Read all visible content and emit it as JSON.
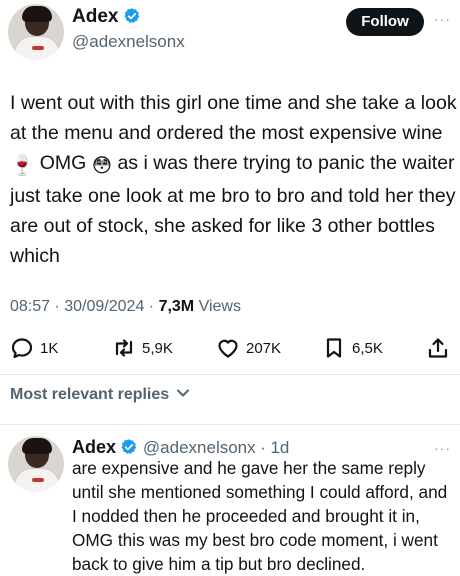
{
  "tweet": {
    "author_name": "Adex",
    "author_handle": "@adexnelsonx",
    "follow_label": "Follow",
    "text_part1": "I went out with this girl one time and she take a look at the menu and ordered the most expensive wine ",
    "wine_emoji": "🍷",
    "text_part2": " OMG ",
    "flushed_emoji": "😳",
    "text_part3": " as i was there trying to panic the waiter just take one look at me bro to bro and told her they are out of stock, she asked for like 3 other bottles which",
    "time": "08:57 · 30/09/2024 · ",
    "views_count": "7,3M",
    "views_label": " Views"
  },
  "actions": {
    "replies": "1K",
    "reposts": "5,9K",
    "likes": "207K",
    "bookmarks": "6,5K"
  },
  "sort_label": "Most relevant replies",
  "reply": {
    "author_name": "Adex",
    "author_handle": "@adexnelsonx",
    "age": "· 1d",
    "text": "are expensive and he gave her the same reply until she mentioned something I could afford, and I nodded then he proceeded and brought it in, OMG this was my best bro code moment, i went back to give him a tip but bro declined."
  },
  "colors": {
    "verified": "#1d9bf0",
    "secondary_text": "#536471",
    "follow_bg": "#0f1419"
  }
}
